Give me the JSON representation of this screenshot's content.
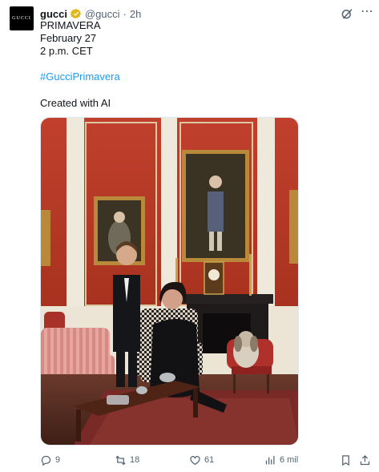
{
  "account": {
    "display_name": "gucci",
    "handle": "@gucci",
    "separator": "·",
    "time": "2h",
    "avatar_text": "GUCCI"
  },
  "post": {
    "line1": "PRIMAVERA",
    "line2": "February 27",
    "line3": "2 p.m. CET",
    "hashtag": "#GucciPrimavera",
    "note": "Created with AI"
  },
  "metrics": {
    "replies": "9",
    "reposts": "18",
    "likes": "61",
    "views": "6 mil"
  },
  "colors": {
    "link": "#1d9bf0",
    "verified_gold": "#e2b719",
    "muted": "#536471"
  },
  "icons": [
    "reply-icon",
    "repost-icon",
    "like-icon",
    "views-icon",
    "bookmark-icon",
    "share-icon",
    "grok-icon",
    "more-icon",
    "verified-icon"
  ]
}
